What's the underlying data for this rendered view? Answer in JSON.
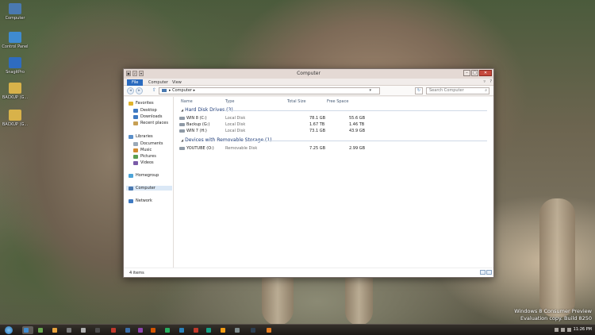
{
  "desktop": {
    "icons": [
      {
        "label": "Computer",
        "color": "#4a79b0"
      },
      {
        "label": "Control Panel",
        "color": "#3f8bd0"
      },
      {
        "label": "SnagitPro",
        "color": "#2f6cbf"
      },
      {
        "label": "BACKUP (G...",
        "color": "#d8b24a"
      },
      {
        "label": "BACKUP (G...",
        "color": "#d8b24a"
      }
    ]
  },
  "window": {
    "title": "Computer",
    "quick_access": [
      "▣",
      "✓",
      "▾"
    ],
    "controls": {
      "minimize": "–",
      "maximize": "□",
      "close": "✕"
    },
    "ribbon_tabs": [
      "File",
      "Computer",
      "View"
    ],
    "address": {
      "path": "Computer",
      "arrow": "▸"
    },
    "search_placeholder": "Search Computer",
    "nav_pane": {
      "favorites_header": "Favorites",
      "favorites": [
        "Desktop",
        "Downloads",
        "Recent places"
      ],
      "libraries_header": "Libraries",
      "libraries": [
        "Documents",
        "Music",
        "Pictures",
        "Videos"
      ],
      "homegroup": "Homegroup",
      "computer": "Computer",
      "network": "Network"
    },
    "columns": {
      "name": "Name",
      "type": "Type",
      "total": "Total Size",
      "free": "Free Space"
    },
    "groups": [
      {
        "header": "Hard Disk Drives (3)",
        "items": [
          {
            "name": "WIN 8 (C:)",
            "type": "Local Disk",
            "total": "78.1 GB",
            "free": "55.6 GB"
          },
          {
            "name": "Backup (G:)",
            "type": "Local Disk",
            "total": "1.67 TB",
            "free": "1.46 TB"
          },
          {
            "name": "WIN 7 (H:)",
            "type": "Local Disk",
            "total": "73.1 GB",
            "free": "43.9 GB"
          }
        ]
      },
      {
        "header": "Devices with Removable Storage (1)",
        "items": [
          {
            "name": "YOUTUBE (O:)",
            "type": "Removable Disk",
            "total": "7.25 GB",
            "free": "2.99 GB"
          }
        ]
      }
    ],
    "status": {
      "items": "4 items"
    }
  },
  "watermark": {
    "line1": "Windows 8 Consumer Preview",
    "line2": "Evaluation copy. Build 8250"
  },
  "taskbar": {
    "clock": "11:26 PM",
    "buttons": [
      "#3f8bd0",
      "#6aa84f",
      "#e8a33c",
      "#7a7a7a",
      "#b0b0b0",
      "#4c4c4c",
      "#c0392b",
      "#3b6ea8",
      "#8e44ad",
      "#d35400",
      "#27ae60",
      "#2980b9",
      "#c0392b",
      "#16a085",
      "#f39c12",
      "#7f8c8d",
      "#2c3e50",
      "#e67e22"
    ]
  }
}
